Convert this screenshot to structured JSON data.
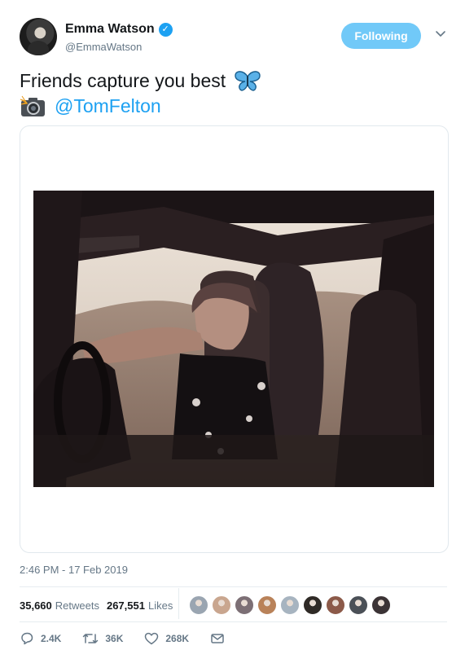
{
  "author": {
    "display_name": "Emma Watson",
    "handle": "@EmmaWatson",
    "verified": true,
    "follow_button_label": "Following"
  },
  "tweet": {
    "text": "Friends capture you best",
    "emoji_1": "butterfly-icon",
    "emoji_2": "camera-flash-icon",
    "mention": "@TomFelton",
    "timestamp": "2:46 PM - 17 Feb 2019"
  },
  "stats": {
    "retweets_count": "35,660",
    "retweets_label": "Retweets",
    "likes_count": "267,551",
    "likes_label": "Likes"
  },
  "actions": {
    "reply_count": "2.4K",
    "retweet_count": "36K",
    "like_count": "268K"
  },
  "colors": {
    "accent": "#1da1f2",
    "follow_button": "#71c9f8",
    "secondary_text": "#657786"
  },
  "likers": [
    {
      "name": "liker-1",
      "color": "#9aa5b1"
    },
    {
      "name": "liker-2",
      "color": "#c9a68f"
    },
    {
      "name": "liker-3",
      "color": "#7c6f75"
    },
    {
      "name": "liker-4",
      "color": "#b98259"
    },
    {
      "name": "liker-5",
      "color": "#a7b4c0"
    },
    {
      "name": "liker-6",
      "color": "#2f2a26"
    },
    {
      "name": "liker-7",
      "color": "#8c5a49"
    },
    {
      "name": "liker-8",
      "color": "#4b5057"
    },
    {
      "name": "liker-9",
      "color": "#3b3335"
    }
  ]
}
